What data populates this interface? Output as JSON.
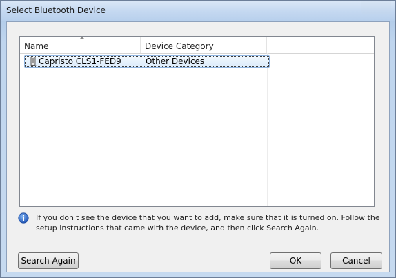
{
  "window": {
    "title": "Select Bluetooth Device"
  },
  "list": {
    "columns": [
      "Name",
      "Device Category",
      ""
    ],
    "sorted_column": "Name",
    "rows": [
      {
        "name": "Capristo CLS1-FED9",
        "category": "Other Devices",
        "icon": "bluetooth-device-icon",
        "selected": true
      }
    ]
  },
  "info": {
    "icon": "info-icon",
    "text": "If you don't see the device that you want to add, make sure that it is turned on. Follow the setup instructions that came with the device, and then click Search Again."
  },
  "buttons": {
    "search_again": "Search Again",
    "ok": "OK",
    "cancel": "Cancel"
  },
  "colors": {
    "selection_fill": "#dcecfb",
    "selection_border": "#8fb4e0",
    "info_icon": "#2f6fd0"
  }
}
